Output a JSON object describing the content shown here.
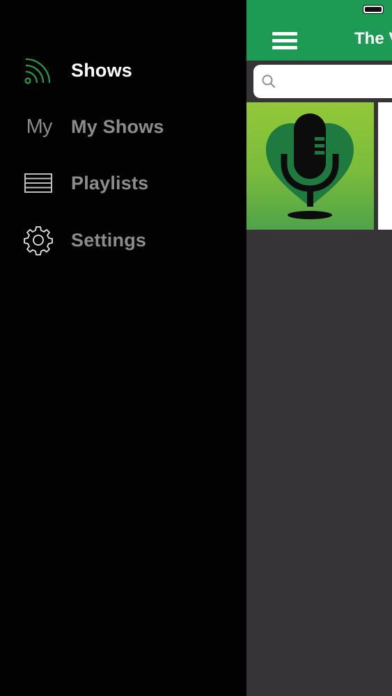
{
  "drawer": {
    "items": [
      {
        "label": "Shows",
        "icon": "rss-feed-icon",
        "active": true
      },
      {
        "label": "My Shows",
        "icon": "my-text-icon",
        "icon_text": "My",
        "active": false
      },
      {
        "label": "Playlists",
        "icon": "list-icon",
        "active": false
      },
      {
        "label": "Settings",
        "icon": "gear-icon",
        "active": false
      }
    ]
  },
  "main": {
    "title": "The V",
    "search": {
      "placeholder": ""
    },
    "shows": [
      {
        "artwork": "podcast-microphone-artwork"
      },
      {
        "artwork": "blank-artwork"
      }
    ]
  },
  "colors": {
    "accent_green": "#1d9b54",
    "drawer_bg": "#030203",
    "content_bg": "#363436",
    "rss_icon_green": "#2a9a4f"
  }
}
